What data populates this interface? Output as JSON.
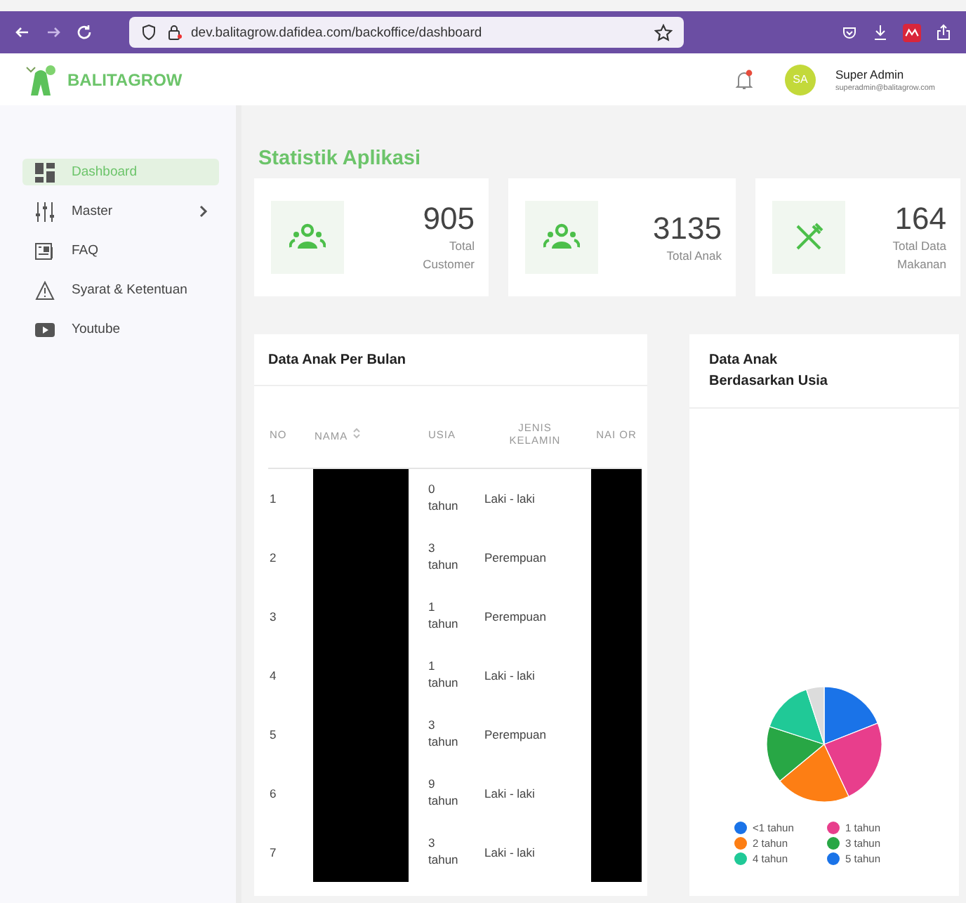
{
  "browser": {
    "url": "dev.balitagrow.dafidea.com/backoffice/dashboard"
  },
  "header": {
    "brand": "BALITAGROW",
    "avatar": "SA",
    "user_name": "Super Admin",
    "user_email": "superadmin@balitagrow.com"
  },
  "sidebar": {
    "items": [
      {
        "label": "Dashboard",
        "kind": "dashboard",
        "selected": true,
        "has_submenu": false
      },
      {
        "label": "Master",
        "kind": "master",
        "selected": false,
        "has_submenu": true
      },
      {
        "label": "FAQ",
        "kind": "faq",
        "selected": false,
        "has_submenu": false
      },
      {
        "label": "Syarat & Ketentuan",
        "kind": "terms",
        "selected": false,
        "has_submenu": false
      },
      {
        "label": "Youtube",
        "kind": "youtube",
        "selected": false,
        "has_submenu": false
      }
    ]
  },
  "page_title": "Statistik Aplikasi",
  "stats": [
    {
      "value": "905",
      "label": "Total Customer",
      "kind": "people"
    },
    {
      "value": "3135",
      "label": "Total Anak",
      "kind": "people"
    },
    {
      "value": "164",
      "label": "Total Data Makanan",
      "kind": "food"
    }
  ],
  "table": {
    "title": "Data Anak Per Bulan",
    "columns": [
      "NO",
      "NAMA",
      "USIA",
      "JENIS KELAMIN",
      "NAI OR"
    ],
    "rows": [
      {
        "no": "1",
        "age": "0 tahun",
        "gender": "Laki - laki"
      },
      {
        "no": "2",
        "age": "3 tahun",
        "gender": "Perempuan"
      },
      {
        "no": "3",
        "age": "1 tahun",
        "gender": "Perempuan"
      },
      {
        "no": "4",
        "age": "1 tahun",
        "gender": "Laki - laki"
      },
      {
        "no": "5",
        "age": "3 tahun",
        "gender": "Perempuan"
      },
      {
        "no": "6",
        "age": "9 tahun",
        "gender": "Laki - laki"
      },
      {
        "no": "7",
        "age": "3 tahun",
        "gender": "Laki - laki"
      }
    ]
  },
  "age_chart": {
    "title": "Data Anak Berdasarkan Usia",
    "legend": [
      {
        "label": "<1 tahun",
        "color": "#1a73e8"
      },
      {
        "label": "1 tahun",
        "color": "#e83e8c"
      },
      {
        "label": "2 tahun",
        "color": "#fd7e14"
      },
      {
        "label": "3 tahun",
        "color": "#28a745"
      },
      {
        "label": "4 tahun",
        "color": "#20c997"
      },
      {
        "label": "5 tahun",
        "color": "#1a73e8"
      }
    ]
  }
}
